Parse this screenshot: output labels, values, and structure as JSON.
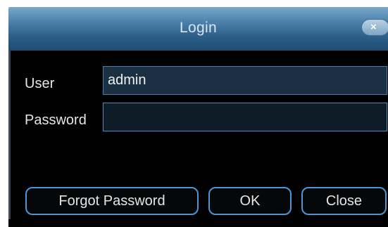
{
  "dialog": {
    "title": "Login",
    "close_icon": "×"
  },
  "form": {
    "user_label": "User",
    "user_value": "admin",
    "password_label": "Password",
    "password_value": ""
  },
  "buttons": {
    "forgot_label": "Forgot Password",
    "ok_label": "OK",
    "close_label": "Close"
  },
  "colors": {
    "titlebar_top": "#79a9c9",
    "titlebar_bottom": "#1f4d73",
    "body_bg": "#000000",
    "accent_border": "#4f95d1"
  }
}
